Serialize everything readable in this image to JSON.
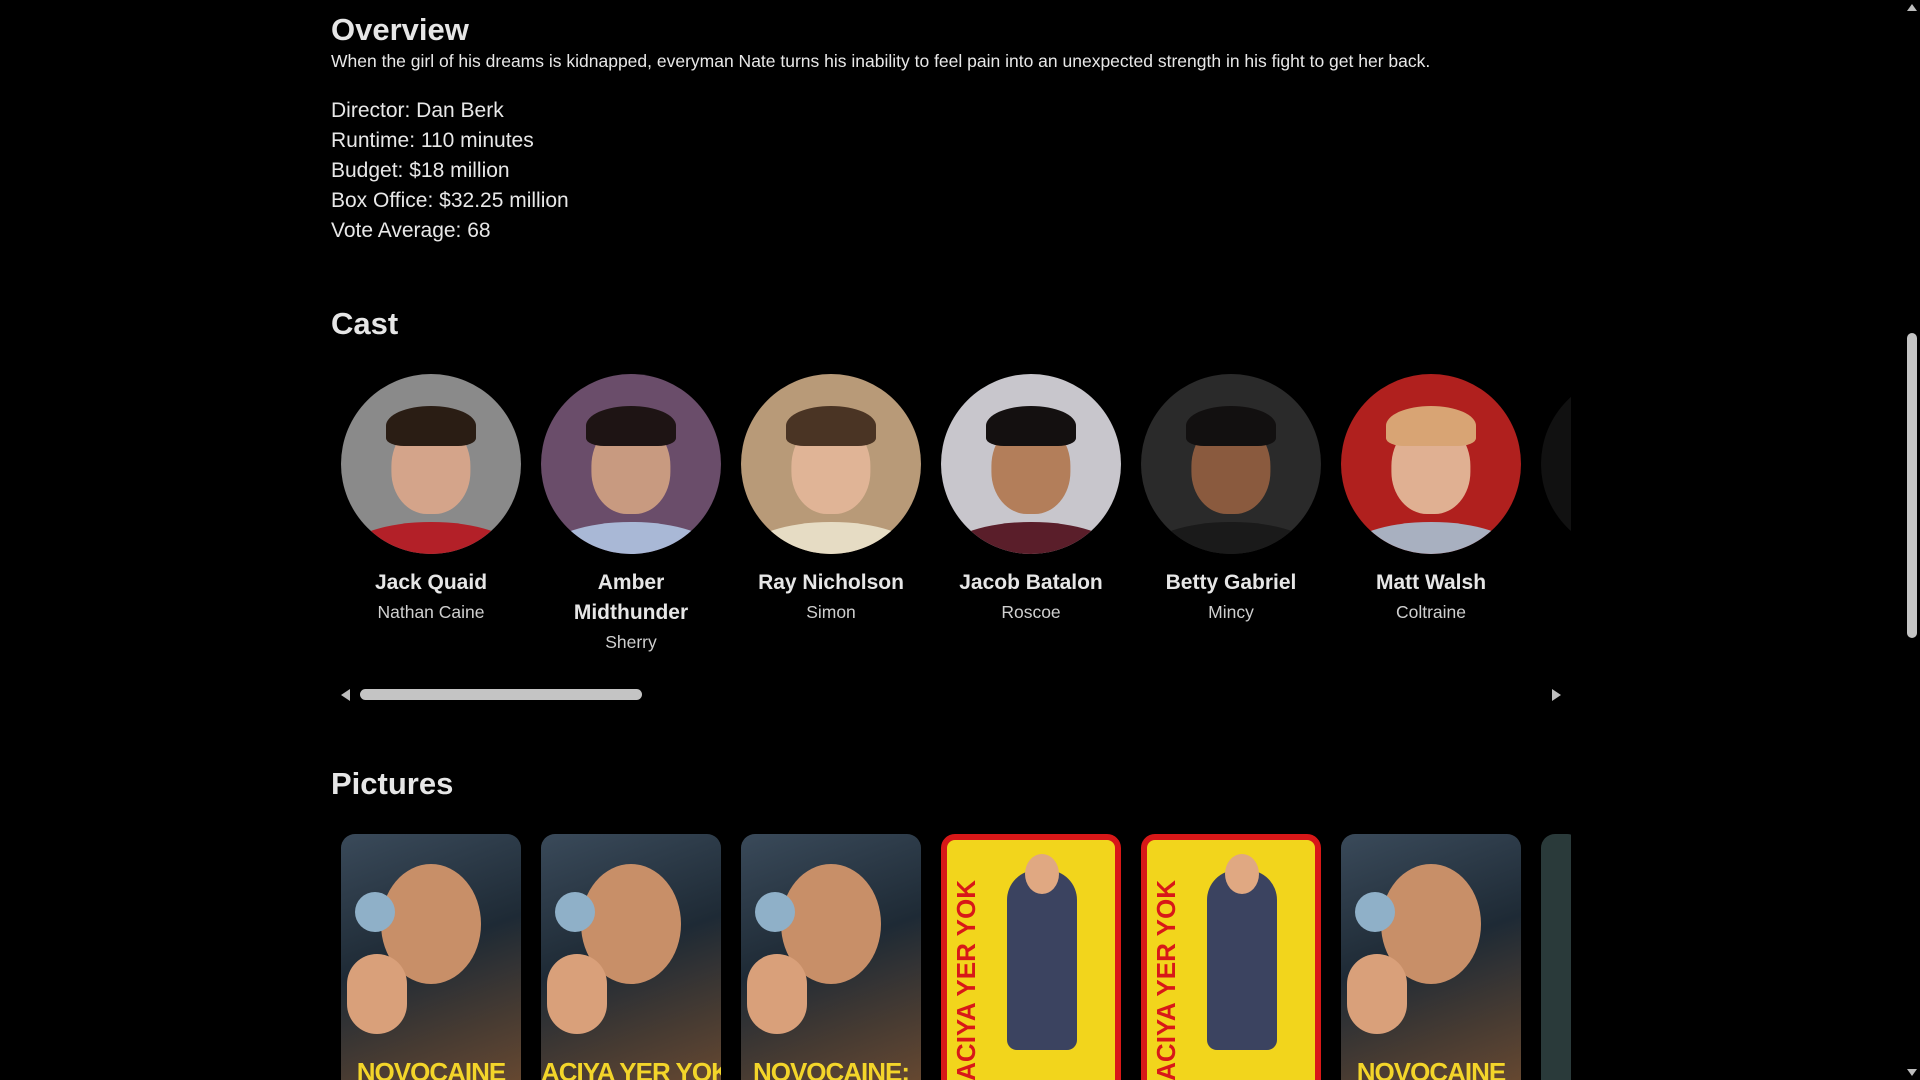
{
  "overview": {
    "title": "Overview",
    "text": "When the girl of his dreams is kidnapped, everyman Nate turns his inability to feel pain into an unexpected strength in his fight to get her back.",
    "facts": [
      "Director: Dan Berk",
      "Runtime: 110 minutes",
      "Budget: $18 million",
      "Box Office: $32.25 million",
      "Vote Average: 68"
    ]
  },
  "cast": {
    "title": "Cast",
    "members": [
      {
        "name": "Jack Quaid",
        "role": "Nathan Caine",
        "bg": "#8a8a8a",
        "skin": "#d4a48a",
        "hair": "#2a1d14",
        "shirt": "#b32028"
      },
      {
        "name": "Amber Midthunder",
        "role": "Sherry",
        "bg": "#6a4d6a",
        "skin": "#c89a80",
        "hair": "#1e1414",
        "shirt": "#a9b8d6"
      },
      {
        "name": "Ray Nicholson",
        "role": "Simon",
        "bg": "#b89a78",
        "skin": "#e0b496",
        "hair": "#4a3424",
        "shirt": "#e6dcc4"
      },
      {
        "name": "Jacob Batalon",
        "role": "Roscoe",
        "bg": "#c8c6cc",
        "skin": "#b37e5a",
        "hair": "#141010",
        "shirt": "#5a1e2a"
      },
      {
        "name": "Betty Gabriel",
        "role": "Mincy",
        "bg": "#2a2a2a",
        "skin": "#8a5a3e",
        "hair": "#121010",
        "shirt": "#1a1a1a"
      },
      {
        "name": "Matt Walsh",
        "role": "Coltraine",
        "bg": "#b0201e",
        "skin": "#e0b092",
        "hair": "#d8a474",
        "shirt": "#a8b0c0"
      }
    ]
  },
  "pictures": {
    "title": "Pictures",
    "items": [
      {
        "style": "dark",
        "caption": "NOVOCAINE"
      },
      {
        "style": "dark",
        "caption": "ACIYA YER YOK"
      },
      {
        "style": "dark",
        "caption": "NOVOCAINE:"
      },
      {
        "style": "yellow",
        "caption": "ACIYA YER YOK"
      },
      {
        "style": "yellow",
        "caption": "ACIYA YER YOK"
      },
      {
        "style": "dark",
        "caption": "NOVOCAINE"
      }
    ]
  }
}
